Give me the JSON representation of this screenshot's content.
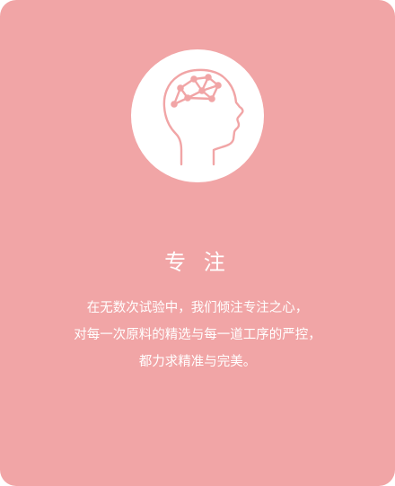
{
  "card": {
    "background": "#f1a5a6",
    "icon": "head-brain-network-icon",
    "title": "专 注",
    "description_lines": [
      "在无数次试验中，我们倾注专注之心，",
      "对每一次原料的精选与每一道工序的严控，",
      "都力求精准与完美。"
    ]
  }
}
